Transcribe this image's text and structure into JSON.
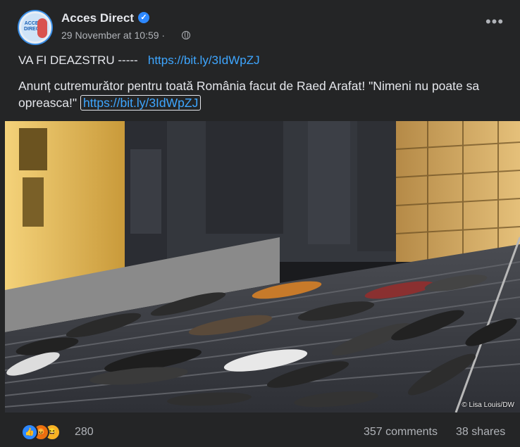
{
  "post": {
    "page_name": "Acces Direct",
    "avatar_text": "ACCES DIRECT",
    "timestamp": "29 November at 10:59",
    "separator": "·",
    "privacy_icon": "globe-icon",
    "more_icon": "more-options-icon",
    "line1_text": "VA FI DEAZSTRU -----",
    "line1_link": "https://bit.ly/3IdWpZJ",
    "line2_text": "Anunț cutremurător pentru toată România facut de Raed Arafat! \"Nimeni nu poate sa opreasca!\"",
    "line2_link": "https://bit.ly/3IdWpZJ",
    "photo_credit": "© Lisa Louis/DW"
  },
  "footer": {
    "reaction_icons": [
      "like-reaction-icon",
      "angry-reaction-icon",
      "haha-reaction-icon"
    ],
    "reaction_count": "280",
    "comments": "357 comments",
    "shares": "38 shares"
  },
  "colors": {
    "background": "#242526",
    "text": "#e4e6eb",
    "secondary": "#b0b3b8",
    "link": "#3ea6ff",
    "verified": "#2d88ff"
  }
}
